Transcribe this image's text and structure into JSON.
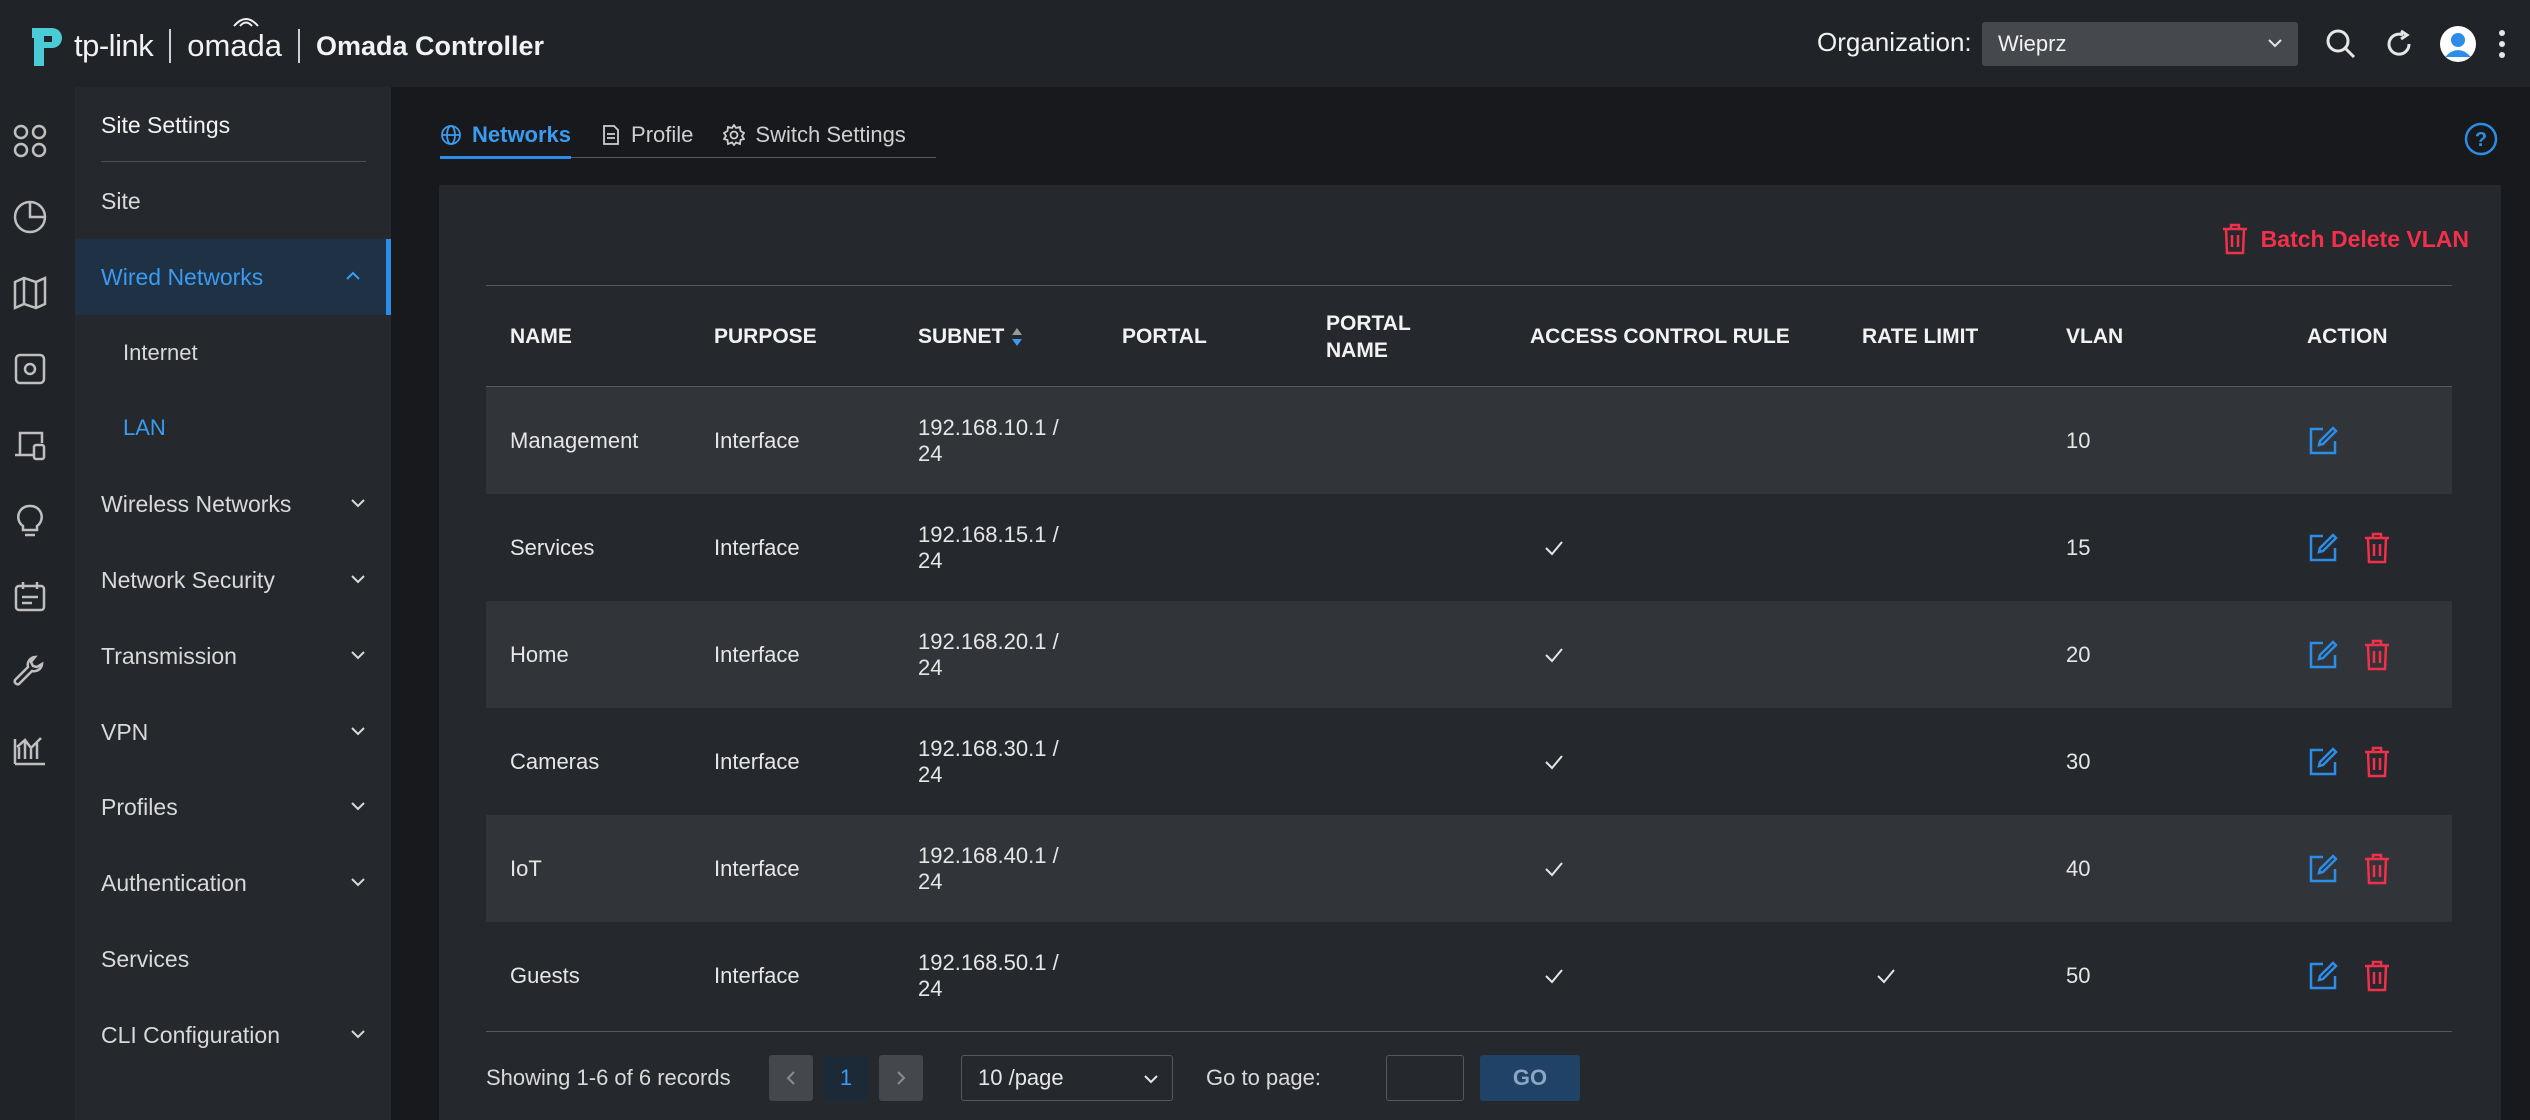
{
  "brand": {
    "tplink": "tp-link",
    "omada": "omada",
    "product": "Omada Controller"
  },
  "header": {
    "org_label": "Organization:",
    "org_value": "Wieprz"
  },
  "sidebar": {
    "title": "Site Settings",
    "items": [
      {
        "label": "Site"
      },
      {
        "label": "Wired Networks"
      },
      {
        "label": "Internet"
      },
      {
        "label": "LAN"
      },
      {
        "label": "Wireless Networks"
      },
      {
        "label": "Network Security"
      },
      {
        "label": "Transmission"
      },
      {
        "label": "VPN"
      },
      {
        "label": "Profiles"
      },
      {
        "label": "Authentication"
      },
      {
        "label": "Services"
      },
      {
        "label": "CLI Configuration"
      }
    ]
  },
  "tabs": [
    {
      "label": "Networks"
    },
    {
      "label": "Profile"
    },
    {
      "label": "Switch Settings"
    }
  ],
  "toolbar": {
    "batch_delete": "Batch Delete VLAN"
  },
  "table": {
    "columns": [
      "NAME",
      "PURPOSE",
      "SUBNET",
      "PORTAL",
      "PORTAL NAME",
      "ACCESS CONTROL RULE",
      "RATE LIMIT",
      "VLAN",
      "ACTION"
    ],
    "rows": [
      {
        "name": "Management",
        "purpose": "Interface",
        "subnet": "192.168.10.1 / 24",
        "portal": "",
        "portal_name": "",
        "acl": false,
        "rate_limit": false,
        "vlan": "10",
        "deletable": false
      },
      {
        "name": "Services",
        "purpose": "Interface",
        "subnet": "192.168.15.1 / 24",
        "portal": "",
        "portal_name": "",
        "acl": true,
        "rate_limit": false,
        "vlan": "15",
        "deletable": true
      },
      {
        "name": "Home",
        "purpose": "Interface",
        "subnet": "192.168.20.1 / 24",
        "portal": "",
        "portal_name": "",
        "acl": true,
        "rate_limit": false,
        "vlan": "20",
        "deletable": true
      },
      {
        "name": "Cameras",
        "purpose": "Interface",
        "subnet": "192.168.30.1 / 24",
        "portal": "",
        "portal_name": "",
        "acl": true,
        "rate_limit": false,
        "vlan": "30",
        "deletable": true
      },
      {
        "name": "IoT",
        "purpose": "Interface",
        "subnet": "192.168.40.1 / 24",
        "portal": "",
        "portal_name": "",
        "acl": true,
        "rate_limit": false,
        "vlan": "40",
        "deletable": true
      },
      {
        "name": "Guests",
        "purpose": "Interface",
        "subnet": "192.168.50.1 / 24",
        "portal": "",
        "portal_name": "",
        "acl": true,
        "rate_limit": true,
        "vlan": "50",
        "deletable": true
      }
    ]
  },
  "pagination": {
    "summary": "Showing 1-6 of 6 records",
    "current_page": "1",
    "page_size": "10 /page",
    "goto_label": "Go to page:",
    "go_button": "GO"
  },
  "colors": {
    "accent": "#2b8de8",
    "danger": "#f2304c",
    "background": "#17191c"
  }
}
